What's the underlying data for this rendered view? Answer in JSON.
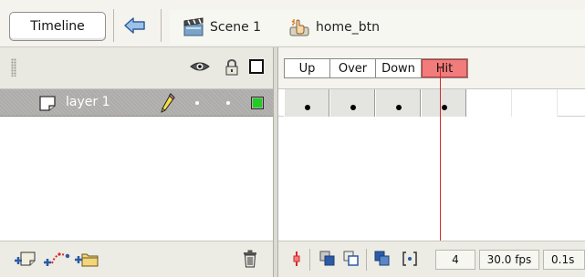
{
  "toolbar": {
    "timeline_label": "Timeline",
    "breadcrumbs": [
      {
        "label": "Scene 1",
        "icon": "scene-clapper-icon"
      },
      {
        "label": "home_btn",
        "icon": "button-symbol-icon"
      }
    ]
  },
  "layers": {
    "header_icons": [
      "eye-icon",
      "lock-icon",
      "outline-icon"
    ],
    "rows": [
      {
        "name": "layer 1",
        "outline_color": "#22cc22"
      }
    ],
    "footer_icons": [
      "insert-layer-icon",
      "add-motion-guide-icon",
      "insert-layer-folder-icon",
      "delete-layer-icon"
    ]
  },
  "frames": {
    "labels": [
      "Up",
      "Over",
      "Down",
      "Hit"
    ],
    "current_label": "Hit",
    "keyframes": [
      true,
      true,
      true,
      true
    ]
  },
  "status": {
    "current_frame": "4",
    "frame_rate": "30.0 fps",
    "elapsed_time": "0.1s"
  },
  "colors": {
    "playhead": "#d42a2a",
    "current_frame_label": "#f27b7b",
    "layer_selected_bg": "#adacaa"
  }
}
